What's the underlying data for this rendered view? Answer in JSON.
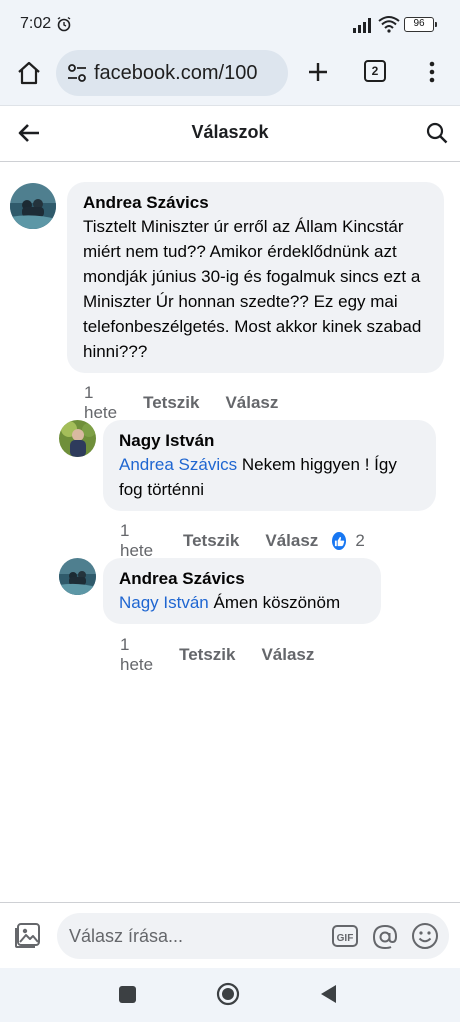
{
  "status_bar": {
    "time": "7:02",
    "battery": "96"
  },
  "browser": {
    "url": "facebook.com/100",
    "tab_count": "2"
  },
  "header": {
    "title": "Válaszok"
  },
  "comments": [
    {
      "author": "Andrea Szávics",
      "mention": "",
      "text": "Tisztelt Miniszter úr erről az Állam Kincstár miért nem tud?? Amikor érdeklődnünk azt mondják június 30-ig és fogalmuk sincs ezt a Miniszter Úr honnan szedte?? Ez egy mai telefonbeszélgetés. Most akkor kinek szabad hinni???",
      "time": "1 hete",
      "like_label": "Tetszik",
      "reply_label": "Válasz"
    },
    {
      "author": "Nagy István",
      "mention": "Andrea Szávics",
      "text": " Nekem higgyen ! Így fog történni",
      "time": "1 hete",
      "like_label": "Tetszik",
      "reply_label": "Válasz",
      "reaction_count": "2"
    },
    {
      "author": "Andrea Szávics",
      "mention": "Nagy István",
      "text": " Ámen köszönöm",
      "time": "1 hete",
      "like_label": "Tetszik",
      "reply_label": "Válasz"
    }
  ],
  "composer": {
    "placeholder": "Válasz írása..."
  },
  "colors": {
    "mention": "#1f66d1",
    "bubble": "#f0f2f5",
    "like_badge": "#1877f2"
  }
}
